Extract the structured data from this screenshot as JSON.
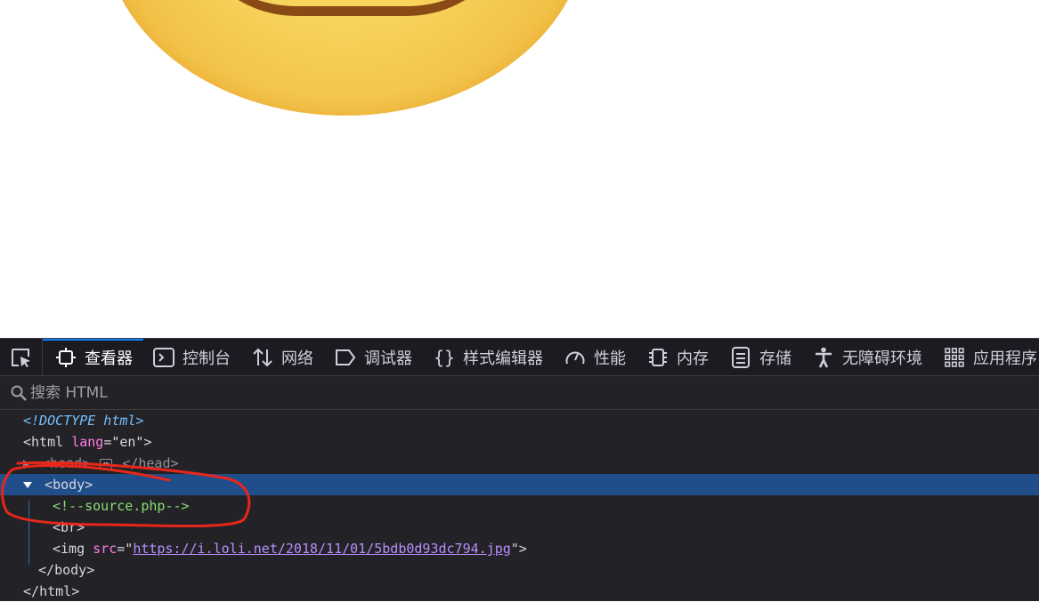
{
  "devtools": {
    "tabs": [
      {
        "label": "查看器",
        "icon": "inspector-icon",
        "active": true
      },
      {
        "label": "控制台",
        "icon": "console-icon"
      },
      {
        "label": "网络",
        "icon": "network-arrows-icon"
      },
      {
        "label": "调试器",
        "icon": "debugger-icon"
      },
      {
        "label": "样式编辑器",
        "icon": "braces-icon"
      },
      {
        "label": "性能",
        "icon": "gauge-icon"
      },
      {
        "label": "内存",
        "icon": "memory-chip-icon"
      },
      {
        "label": "存储",
        "icon": "storage-icon"
      },
      {
        "label": "无障碍环境",
        "icon": "accessibility-icon"
      },
      {
        "label": "应用程序",
        "icon": "grid-apps-icon"
      }
    ],
    "search_placeholder": "搜索 HTML",
    "markup": {
      "doctype": "<!DOCTYPE html>",
      "html_tag": "html",
      "html_attr_name": "lang",
      "html_attr_value": "\"en\"",
      "head_open": "<head>",
      "head_ellipsis": "⋯",
      "head_close": "</head>",
      "body_tag": "body",
      "comment": "<!--source.php-->",
      "br_tag": "br",
      "img_tag": "img",
      "img_attr_name": "src",
      "img_src": "https://i.loli.net/2018/11/01/5bdb0d93dc794.jpg",
      "body_close": "body",
      "html_close": "html"
    }
  },
  "colors": {
    "toolbar_bg": "#1c1b22",
    "panel_bg": "#232327",
    "selected_row": "#204e8a",
    "active_tab_accent": "#0a84ff",
    "attr_name": "#ff7de9",
    "comment": "#86de74",
    "doctype": "#75bfff",
    "link": "#b98eff",
    "annotation_red": "#e8261a"
  }
}
